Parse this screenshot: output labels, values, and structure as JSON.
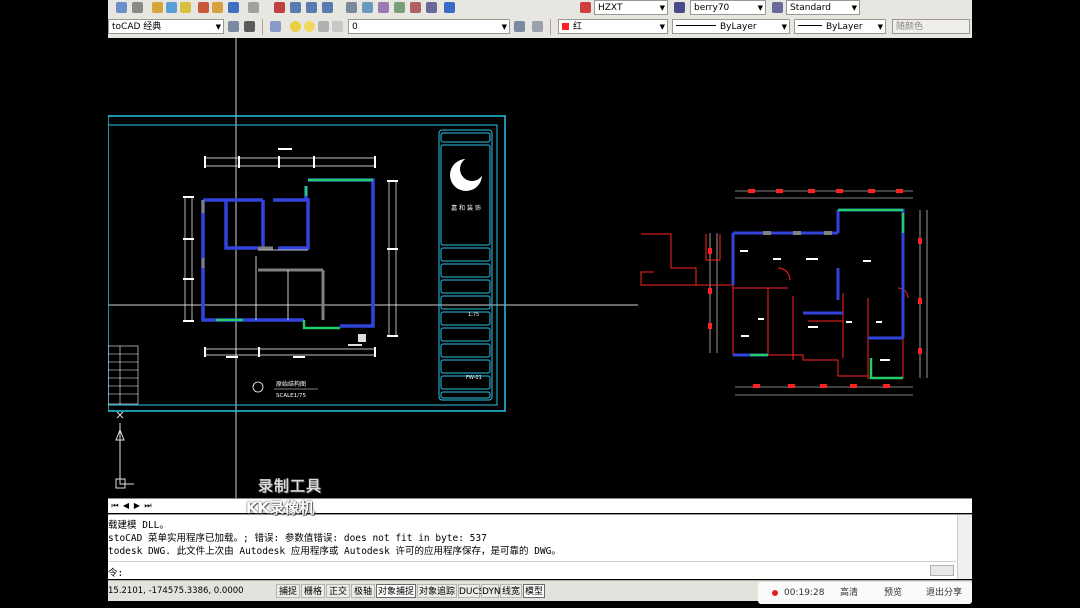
{
  "toolbar": {
    "workspace": "toCAD 经典",
    "layer": "0",
    "text_style": "HZXT",
    "dim_style": "berry70",
    "table_style": "Standard",
    "color": "红",
    "linetype": "ByLayer",
    "lineweight": "ByLayer",
    "plot_style": "随颜色"
  },
  "colors": {
    "toolbar_bg": "#e8e6e1",
    "frame": "#27c4e6",
    "wall": "#3344dd",
    "window": "#22cc66",
    "dim": "#ffffff",
    "red": "#ff2222",
    "record": "#e02020"
  },
  "drawing": {
    "plan_title": "原始结构图",
    "plan_scale": "SCALE1/75",
    "titleblock_scale": "1:75",
    "titleblock_no": "FW-01",
    "company": "嘉 和 装 饰"
  },
  "command": {
    "lines": [
      "载建模 DLL。",
      "stoCAD 菜单实用程序已加载。; 错误: 参数值错误: does not fit in byte: 537",
      "todesk DWG.   此文件上次由 Autodesk 应用程序或 Autodesk 许可的应用程序保存，是可靠的 DWG。"
    ],
    "prompt": "令:"
  },
  "status": {
    "coords": "15.2101, -174575.3386, 0.0000",
    "buttons": [
      "捕捉",
      "栅格",
      "正交",
      "极轴",
      "对象捕捉",
      "对象追踪",
      "DUCS",
      "DYN",
      "线宽",
      "模型"
    ],
    "active": [
      "对象捕捉",
      "模型"
    ]
  },
  "recorder": {
    "time": "00:19:28",
    "quality": "高清",
    "preview": "预览",
    "exit_share": "退出分享"
  },
  "watermark": {
    "line1": "录制工具",
    "line2": "KK录像机"
  }
}
